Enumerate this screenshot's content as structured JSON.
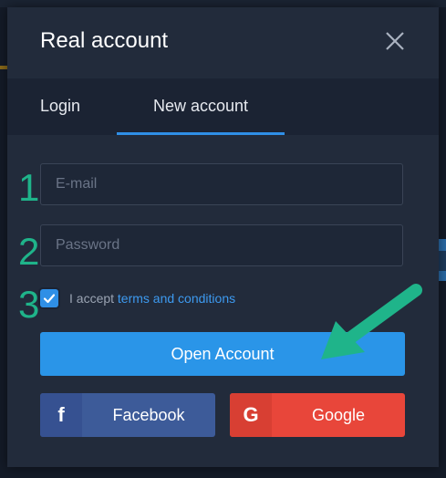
{
  "modal": {
    "title": "Real account"
  },
  "tabs": [
    {
      "label": "Login",
      "active": false
    },
    {
      "label": "New account",
      "active": true
    }
  ],
  "form": {
    "email": {
      "placeholder": "E-mail",
      "value": ""
    },
    "password": {
      "placeholder": "Password",
      "value": ""
    },
    "accept_prefix": "I accept ",
    "terms_link": "terms and conditions",
    "accept_checked": true,
    "submit_label": "Open Account"
  },
  "social": {
    "facebook": {
      "icon_glyph": "f",
      "label": "Facebook"
    },
    "google": {
      "icon_glyph": "G",
      "label": "Google"
    }
  },
  "annotations": {
    "step1": "1",
    "step2": "2",
    "step3": "3"
  },
  "colors": {
    "accent": "#2a95e8",
    "facebook": "#3d5b99",
    "google": "#e8463a",
    "annotation": "#1fb48a"
  }
}
